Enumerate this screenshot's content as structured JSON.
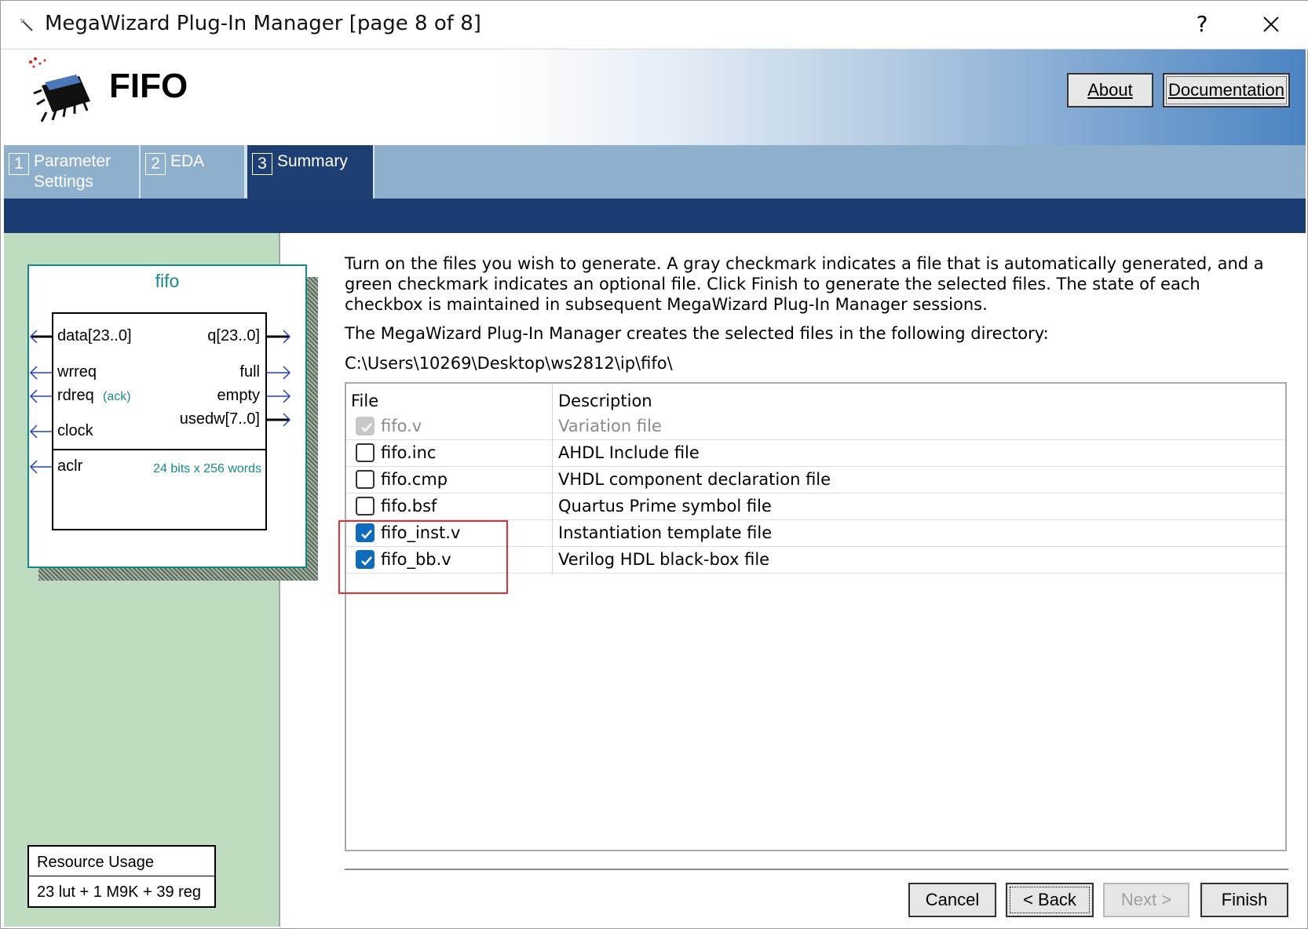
{
  "window": {
    "title": "MegaWizard Plug-In Manager [page 8 of 8]",
    "help_label": "?",
    "close_label": "×"
  },
  "header": {
    "component_name": "FIFO",
    "about_label": "About",
    "documentation_label": "Documentation"
  },
  "tabs": [
    {
      "num": "1",
      "label_line1": "Parameter",
      "label_line2": "Settings",
      "active": false
    },
    {
      "num": "2",
      "label_line1": "EDA",
      "label_line2": "",
      "active": true
    },
    {
      "num": "3",
      "label_line1": "Summary",
      "label_line2": "",
      "active": true
    }
  ],
  "symbol": {
    "title": "fifo",
    "ports_in": [
      "data[23..0]",
      "wrreq",
      "rdreq",
      "clock",
      "aclr"
    ],
    "rdreq_note": "(ack)",
    "ports_out": [
      "q[23..0]",
      "full",
      "empty",
      "usedw[7..0]"
    ],
    "size_note": "24 bits x 256 words"
  },
  "resource": {
    "label": "Resource Usage",
    "value": "23 lut + 1 M9K + 39 reg"
  },
  "content": {
    "intro": "Turn on the files you wish to generate. A gray checkmark indicates a file that is automatically generated, and a green checkmark indicates an optional file. Click Finish to generate the selected files. The state of each checkbox is maintained in subsequent MegaWizard Plug-In Manager sessions.",
    "directory_label": "The MegaWizard Plug-In Manager creates the selected files in the following directory:",
    "directory_path": "C:\\Users\\10269\\Desktop\\ws2812\\ip\\fifo\\"
  },
  "table": {
    "col_file": "File",
    "col_description": "Description",
    "rows": [
      {
        "file": "fifo.v",
        "description": "Variation file",
        "state": "auto"
      },
      {
        "file": "fifo.inc",
        "description": "AHDL Include file",
        "state": "unchecked"
      },
      {
        "file": "fifo.cmp",
        "description": "VHDL component declaration file",
        "state": "unchecked"
      },
      {
        "file": "fifo.bsf",
        "description": "Quartus Prime symbol file",
        "state": "unchecked"
      },
      {
        "file": "fifo_inst.v",
        "description": "Instantiation template file",
        "state": "checked"
      },
      {
        "file": "fifo_bb.v",
        "description": "Verilog HDL black-box file",
        "state": "checked"
      }
    ]
  },
  "buttons": {
    "cancel": "Cancel",
    "back": "< Back",
    "next": "Next >",
    "finish": "Finish"
  },
  "colors": {
    "accent_navy": "#1b3c72",
    "tab_blue": "#8eb0cc",
    "panel_green": "#bfdcc0",
    "checkbox_blue": "#0f6cbd",
    "highlight_red": "#e0303a"
  }
}
